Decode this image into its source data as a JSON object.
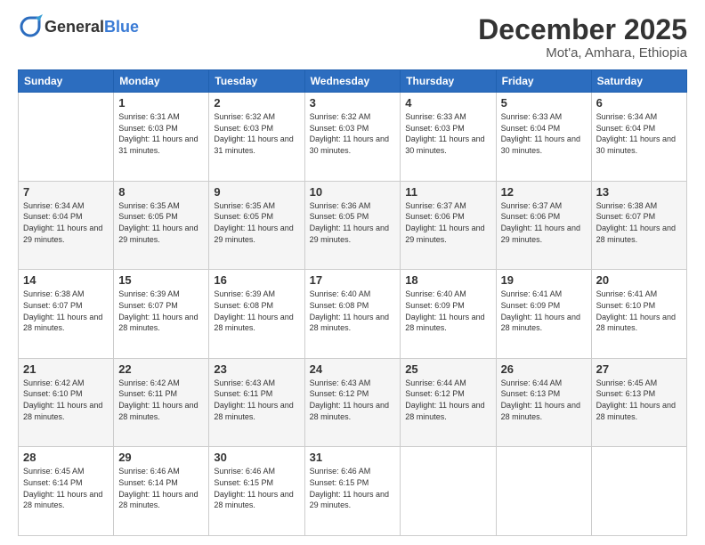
{
  "logo": {
    "general": "General",
    "blue": "Blue"
  },
  "header": {
    "month": "December 2025",
    "location": "Mot'a, Amhara, Ethiopia"
  },
  "days_of_week": [
    "Sunday",
    "Monday",
    "Tuesday",
    "Wednesday",
    "Thursday",
    "Friday",
    "Saturday"
  ],
  "weeks": [
    [
      {
        "day": "",
        "sunrise": "",
        "sunset": "",
        "daylight": ""
      },
      {
        "day": "1",
        "sunrise": "Sunrise: 6:31 AM",
        "sunset": "Sunset: 6:03 PM",
        "daylight": "Daylight: 11 hours and 31 minutes."
      },
      {
        "day": "2",
        "sunrise": "Sunrise: 6:32 AM",
        "sunset": "Sunset: 6:03 PM",
        "daylight": "Daylight: 11 hours and 31 minutes."
      },
      {
        "day": "3",
        "sunrise": "Sunrise: 6:32 AM",
        "sunset": "Sunset: 6:03 PM",
        "daylight": "Daylight: 11 hours and 30 minutes."
      },
      {
        "day": "4",
        "sunrise": "Sunrise: 6:33 AM",
        "sunset": "Sunset: 6:03 PM",
        "daylight": "Daylight: 11 hours and 30 minutes."
      },
      {
        "day": "5",
        "sunrise": "Sunrise: 6:33 AM",
        "sunset": "Sunset: 6:04 PM",
        "daylight": "Daylight: 11 hours and 30 minutes."
      },
      {
        "day": "6",
        "sunrise": "Sunrise: 6:34 AM",
        "sunset": "Sunset: 6:04 PM",
        "daylight": "Daylight: 11 hours and 30 minutes."
      }
    ],
    [
      {
        "day": "7",
        "sunrise": "Sunrise: 6:34 AM",
        "sunset": "Sunset: 6:04 PM",
        "daylight": "Daylight: 11 hours and 29 minutes."
      },
      {
        "day": "8",
        "sunrise": "Sunrise: 6:35 AM",
        "sunset": "Sunset: 6:05 PM",
        "daylight": "Daylight: 11 hours and 29 minutes."
      },
      {
        "day": "9",
        "sunrise": "Sunrise: 6:35 AM",
        "sunset": "Sunset: 6:05 PM",
        "daylight": "Daylight: 11 hours and 29 minutes."
      },
      {
        "day": "10",
        "sunrise": "Sunrise: 6:36 AM",
        "sunset": "Sunset: 6:05 PM",
        "daylight": "Daylight: 11 hours and 29 minutes."
      },
      {
        "day": "11",
        "sunrise": "Sunrise: 6:37 AM",
        "sunset": "Sunset: 6:06 PM",
        "daylight": "Daylight: 11 hours and 29 minutes."
      },
      {
        "day": "12",
        "sunrise": "Sunrise: 6:37 AM",
        "sunset": "Sunset: 6:06 PM",
        "daylight": "Daylight: 11 hours and 29 minutes."
      },
      {
        "day": "13",
        "sunrise": "Sunrise: 6:38 AM",
        "sunset": "Sunset: 6:07 PM",
        "daylight": "Daylight: 11 hours and 28 minutes."
      }
    ],
    [
      {
        "day": "14",
        "sunrise": "Sunrise: 6:38 AM",
        "sunset": "Sunset: 6:07 PM",
        "daylight": "Daylight: 11 hours and 28 minutes."
      },
      {
        "day": "15",
        "sunrise": "Sunrise: 6:39 AM",
        "sunset": "Sunset: 6:07 PM",
        "daylight": "Daylight: 11 hours and 28 minutes."
      },
      {
        "day": "16",
        "sunrise": "Sunrise: 6:39 AM",
        "sunset": "Sunset: 6:08 PM",
        "daylight": "Daylight: 11 hours and 28 minutes."
      },
      {
        "day": "17",
        "sunrise": "Sunrise: 6:40 AM",
        "sunset": "Sunset: 6:08 PM",
        "daylight": "Daylight: 11 hours and 28 minutes."
      },
      {
        "day": "18",
        "sunrise": "Sunrise: 6:40 AM",
        "sunset": "Sunset: 6:09 PM",
        "daylight": "Daylight: 11 hours and 28 minutes."
      },
      {
        "day": "19",
        "sunrise": "Sunrise: 6:41 AM",
        "sunset": "Sunset: 6:09 PM",
        "daylight": "Daylight: 11 hours and 28 minutes."
      },
      {
        "day": "20",
        "sunrise": "Sunrise: 6:41 AM",
        "sunset": "Sunset: 6:10 PM",
        "daylight": "Daylight: 11 hours and 28 minutes."
      }
    ],
    [
      {
        "day": "21",
        "sunrise": "Sunrise: 6:42 AM",
        "sunset": "Sunset: 6:10 PM",
        "daylight": "Daylight: 11 hours and 28 minutes."
      },
      {
        "day": "22",
        "sunrise": "Sunrise: 6:42 AM",
        "sunset": "Sunset: 6:11 PM",
        "daylight": "Daylight: 11 hours and 28 minutes."
      },
      {
        "day": "23",
        "sunrise": "Sunrise: 6:43 AM",
        "sunset": "Sunset: 6:11 PM",
        "daylight": "Daylight: 11 hours and 28 minutes."
      },
      {
        "day": "24",
        "sunrise": "Sunrise: 6:43 AM",
        "sunset": "Sunset: 6:12 PM",
        "daylight": "Daylight: 11 hours and 28 minutes."
      },
      {
        "day": "25",
        "sunrise": "Sunrise: 6:44 AM",
        "sunset": "Sunset: 6:12 PM",
        "daylight": "Daylight: 11 hours and 28 minutes."
      },
      {
        "day": "26",
        "sunrise": "Sunrise: 6:44 AM",
        "sunset": "Sunset: 6:13 PM",
        "daylight": "Daylight: 11 hours and 28 minutes."
      },
      {
        "day": "27",
        "sunrise": "Sunrise: 6:45 AM",
        "sunset": "Sunset: 6:13 PM",
        "daylight": "Daylight: 11 hours and 28 minutes."
      }
    ],
    [
      {
        "day": "28",
        "sunrise": "Sunrise: 6:45 AM",
        "sunset": "Sunset: 6:14 PM",
        "daylight": "Daylight: 11 hours and 28 minutes."
      },
      {
        "day": "29",
        "sunrise": "Sunrise: 6:46 AM",
        "sunset": "Sunset: 6:14 PM",
        "daylight": "Daylight: 11 hours and 28 minutes."
      },
      {
        "day": "30",
        "sunrise": "Sunrise: 6:46 AM",
        "sunset": "Sunset: 6:15 PM",
        "daylight": "Daylight: 11 hours and 28 minutes."
      },
      {
        "day": "31",
        "sunrise": "Sunrise: 6:46 AM",
        "sunset": "Sunset: 6:15 PM",
        "daylight": "Daylight: 11 hours and 29 minutes."
      },
      {
        "day": "",
        "sunrise": "",
        "sunset": "",
        "daylight": ""
      },
      {
        "day": "",
        "sunrise": "",
        "sunset": "",
        "daylight": ""
      },
      {
        "day": "",
        "sunrise": "",
        "sunset": "",
        "daylight": ""
      }
    ]
  ]
}
